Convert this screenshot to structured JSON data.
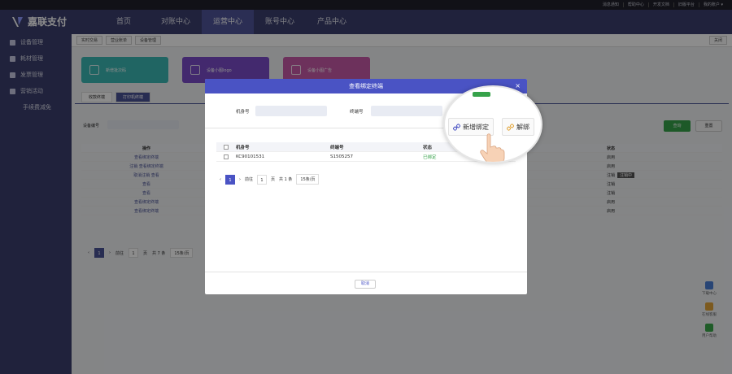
{
  "top_links": [
    "消息通知",
    "帮助中心",
    "开发文档",
    "旧版平台",
    "我的账户 ▾"
  ],
  "brand": {
    "name": "嘉联支付"
  },
  "nav": [
    "首页",
    "对账中心",
    "运营中心",
    "账号中心",
    "产品中心"
  ],
  "sidebar": [
    {
      "label": "设备管理",
      "icon": "grid-icon"
    },
    {
      "label": "耗材管理",
      "icon": "doc-icon"
    },
    {
      "label": "发票管理",
      "icon": "invoice-icon"
    },
    {
      "label": "营销活动",
      "icon": "campaign-icon"
    },
    {
      "label": "手续费减免",
      "icon": ""
    }
  ],
  "page_tabs": [
    "实时交易",
    "营业账单",
    "设备管理"
  ],
  "page_tabs_close": "关闭",
  "cards": [
    {
      "label": "新增批次码",
      "color": "#3bb8b4"
    },
    {
      "label": "设备小图logo",
      "color": "#7a4cc9"
    },
    {
      "label": "设备小图广告",
      "color": "#c75aa8"
    }
  ],
  "subtabs": [
    "收款终端",
    "打印机终端"
  ],
  "filter": {
    "label": "设备编号"
  },
  "buttons": {
    "search": "查询",
    "reset": "重置"
  },
  "bg_table": {
    "headers": [
      "操作",
      "",
      "状态"
    ],
    "rows": [
      {
        "action": "查看绑定终端",
        "status": "启用",
        "tag": ""
      },
      {
        "action": "注销  查看绑定终端",
        "status": "启用",
        "tag": ""
      },
      {
        "action": "取消注销  查看",
        "status": "注销",
        "tag": "注销中"
      },
      {
        "action": "查看",
        "status": "注销",
        "tag": ""
      },
      {
        "action": "查看",
        "status": "注销",
        "tag": ""
      },
      {
        "action": "查看绑定终端",
        "status": "启用",
        "tag": ""
      },
      {
        "action": "查看绑定终端",
        "status": "启用",
        "tag": ""
      }
    ]
  },
  "bg_pager": {
    "prev": "‹",
    "page": "1",
    "next": "›",
    "goto": "前往",
    "goto_val": "1",
    "page_suffix": "页",
    "total": "共 7 条",
    "size": "15条/页"
  },
  "float_tools": [
    "下载中心",
    "在线客服",
    "用户帮助"
  ],
  "modal": {
    "title": "查看绑定终端",
    "close": "×",
    "filter_labels": [
      "机身号",
      "终端号"
    ],
    "table": {
      "headers": [
        "机身号",
        "终端号",
        "状态"
      ],
      "rows": [
        {
          "sn": "KC90101531",
          "terminal": "S1505257",
          "status": "已绑定"
        }
      ]
    },
    "pager": {
      "prev": "‹",
      "page": "1",
      "next": "›",
      "goto": "前往",
      "goto_val": "1",
      "page_suffix": "页",
      "total": "共 1 条",
      "size": "15条/页"
    },
    "cancel": "取消"
  },
  "magnifier": {
    "add_bind": "新增绑定",
    "unbind": "解绑"
  }
}
